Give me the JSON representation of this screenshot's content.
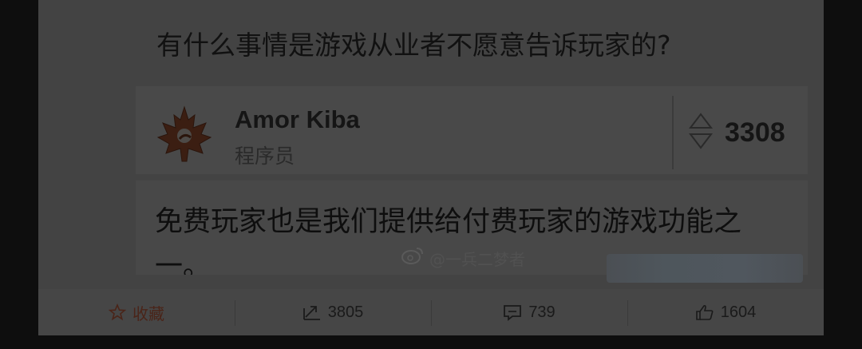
{
  "question": {
    "title": "有什么事情是游戏从业者不愿意告诉玩家的?"
  },
  "author": {
    "name": "Amor Kiba",
    "role": "程序员",
    "avatar_icon": "maple-leaf-avatar-icon"
  },
  "votes": {
    "count": "3308"
  },
  "answer": {
    "text": "免费玩家也是我们提供给付费玩家的游戏功能之一。"
  },
  "watermark": {
    "text": "@一兵二梦者"
  },
  "actions": {
    "collect_label": "收藏",
    "share_count": "3805",
    "comment_count": "739",
    "like_count": "1604"
  },
  "colors": {
    "page_background": "#0e0e0e",
    "frame_background": "#434343",
    "collect_accent": "#4a2418"
  }
}
